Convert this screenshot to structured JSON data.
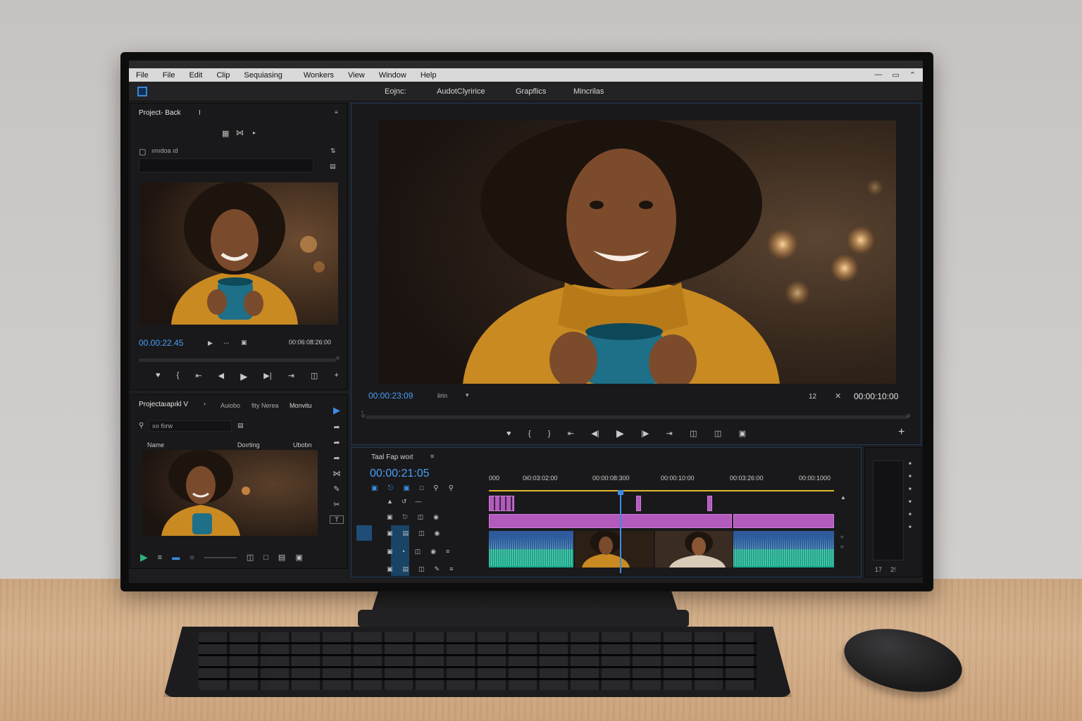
{
  "menubar": {
    "items": [
      "File",
      "File",
      "Edit",
      "Clip",
      "Sequiasing",
      "Wonkers",
      "View",
      "Window",
      "Help"
    ]
  },
  "workspaces": {
    "tabs": [
      "Eojnc:",
      "AudotClyririce",
      "Grapflics",
      "Mincrilas"
    ]
  },
  "source_panel": {
    "title": "Project- Back",
    "title_mark": "I",
    "search_text": "ıınıdoa ıd",
    "timecode_current": "00.00:22.45",
    "timecode_duration": "00:06:08:26:00",
    "dots": "..."
  },
  "project_panel": {
    "title": "Projectaıapıkl V",
    "tabs": [
      "Auiobo",
      "fity Nerea",
      "Monvitu"
    ],
    "search_text": "ıııı fiırw",
    "columns": [
      "Name",
      "Doırting",
      "Ubobn"
    ]
  },
  "program_monitor": {
    "timecode_current": "00:00:23:09",
    "fit_label": "lirin",
    "quality_value": "12",
    "timecode_duration": "00:00:10:00"
  },
  "timeline": {
    "title": "Taal  Fap woıt",
    "timecode": "00:00:21:05",
    "ruler": [
      "000",
      "0i0:03:02:00",
      "00:00:08:300",
      "00:00:10:00",
      "00:03:26:00",
      "00:00:1000"
    ],
    "playhead_fraction": 0.38
  },
  "audio_meter": {
    "labels": [
      "17",
      "2!"
    ]
  },
  "colors": {
    "accent_blue": "#4b9ef5",
    "clip_pink": "#b25bbd",
    "audio_teal": "#16a98c",
    "video_blue": "#2f5a9b",
    "playhead": "#3d8ee6"
  }
}
